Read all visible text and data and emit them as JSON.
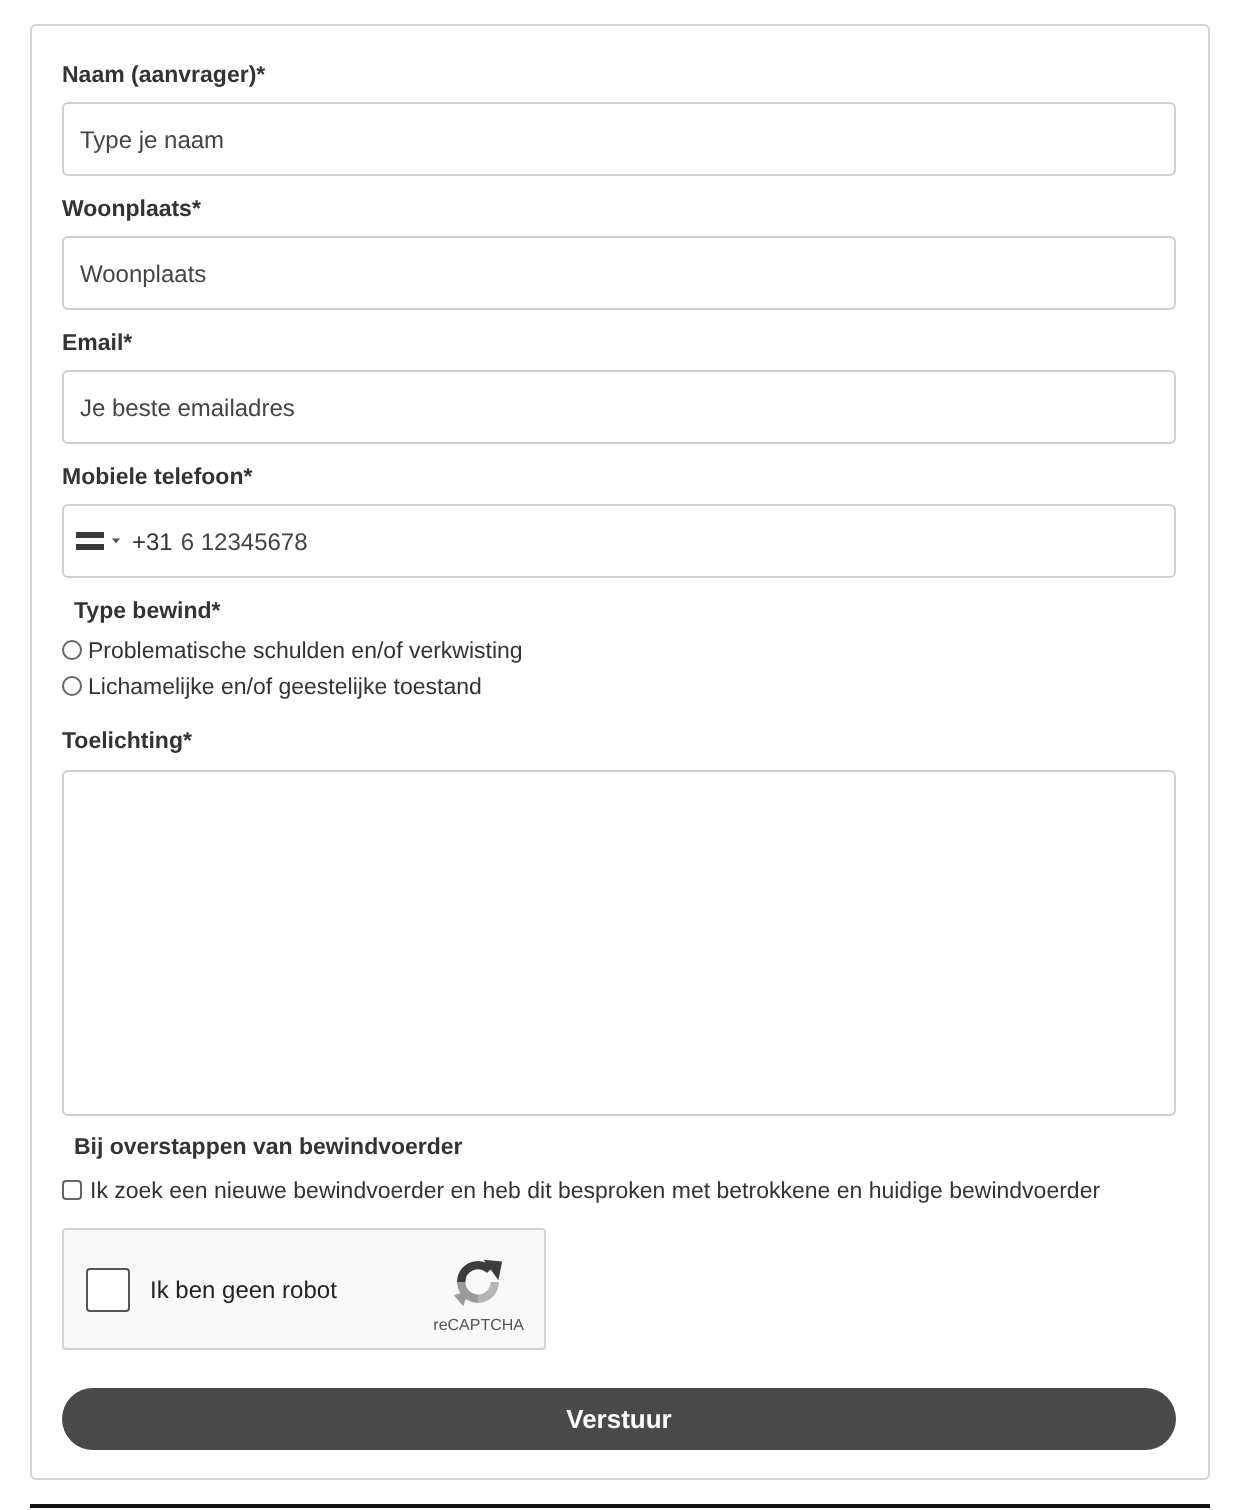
{
  "form": {
    "fields": [
      {
        "kind": "text",
        "label": "Naam (aanvrager)*",
        "placeholder": "Type je naam"
      },
      {
        "kind": "text",
        "label": "Woonplaats*",
        "placeholder": "Woonplaats"
      },
      {
        "kind": "text",
        "label": "Email*",
        "placeholder": "Je beste emailadres"
      },
      {
        "kind": "phone",
        "label": "Mobiele telefoon*",
        "dial_code": "+31",
        "placeholder": "6 12345678"
      },
      {
        "kind": "radio",
        "label": "Type bewind*",
        "options": [
          {
            "label": "Problematische schulden en/of verkwisting",
            "selected": false
          },
          {
            "label": "Lichamelijke en/of geestelijke toestand",
            "selected": false
          }
        ]
      },
      {
        "kind": "textarea",
        "label": "Toelichting*"
      },
      {
        "kind": "checkbox",
        "label": "Bij overstappen van bewindvoerder",
        "options": [
          {
            "label": "Ik zoek een nieuwe bewindvoerder en heb dit besproken met betrokkene en huidige bewindvoerder",
            "checked": false
          }
        ]
      }
    ],
    "captcha": {
      "label": "Ik ben geen robot",
      "brand": "reCAPTCHA",
      "checked": false
    },
    "submit": "Verstuur"
  }
}
